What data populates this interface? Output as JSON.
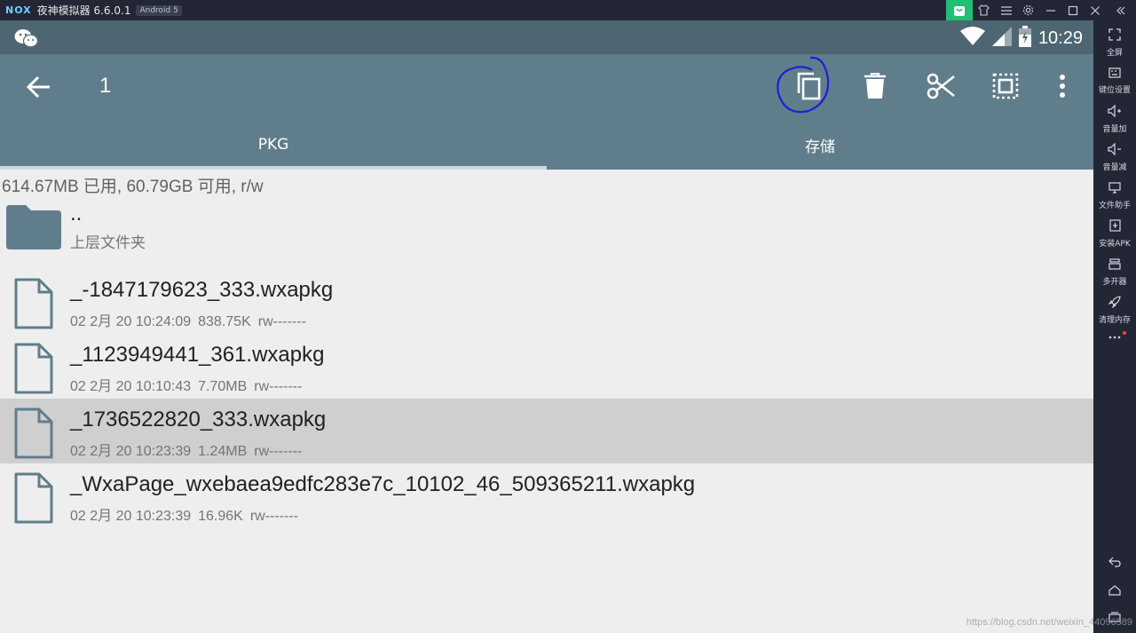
{
  "emulator": {
    "logo": "NOX",
    "title": "夜神模拟器 6.6.0.1",
    "android_badge": "Android 5"
  },
  "status": {
    "time": "10:29"
  },
  "toolbar": {
    "selected_count": "1"
  },
  "tabs": [
    {
      "label": "PKG",
      "active": true
    },
    {
      "label": "存储",
      "active": false
    }
  ],
  "storage_info": "614.67MB 已用, 60.79GB 可用, r/w",
  "parent_folder": {
    "name": "..",
    "label": "上层文件夹"
  },
  "files": [
    {
      "name": "_-1847179623_333.wxapkg",
      "date": "02 2月 20 10:24:09",
      "size": "838.75K",
      "perm": "rw-------",
      "selected": false
    },
    {
      "name": "_1123949441_361.wxapkg",
      "date": "02 2月 20 10:10:43",
      "size": "7.70MB",
      "perm": "rw-------",
      "selected": false
    },
    {
      "name": "_1736522820_333.wxapkg",
      "date": "02 2月 20 10:23:39",
      "size": "1.24MB",
      "perm": "rw-------",
      "selected": true
    },
    {
      "name": "_WxaPage_wxebaea9edfc283e7c_10102_46_509365211.wxapkg",
      "date": "02 2月 20 10:23:39",
      "size": "16.96K",
      "perm": "rw-------",
      "selected": false
    }
  ],
  "sidebar": {
    "items": [
      {
        "label": "全屏",
        "icon": "fullscreen-icon"
      },
      {
        "label": "键位设置",
        "icon": "keyboard-icon"
      },
      {
        "label": "音量加",
        "icon": "volume-up-icon"
      },
      {
        "label": "音量减",
        "icon": "volume-down-icon"
      },
      {
        "label": "文件助手",
        "icon": "file-assistant-icon"
      },
      {
        "label": "安装APK",
        "icon": "install-apk-icon"
      },
      {
        "label": "多开器",
        "icon": "multi-instance-icon"
      },
      {
        "label": "清理内存",
        "icon": "rocket-icon"
      }
    ]
  },
  "watermark": "https://blog.csdn.net/weixin_44096589",
  "colors": {
    "toolbar": "#607d8b",
    "statusbar": "#4e6672",
    "selected_row": "#cfcfcf",
    "annotation_circle": "#1a23d6"
  }
}
